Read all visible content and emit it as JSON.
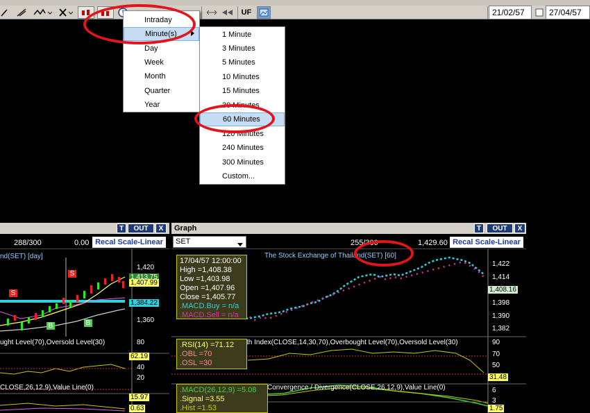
{
  "toolbar": {
    "uf_label": "UF",
    "date_from": "21/02/57",
    "date_to": "27/04/57"
  },
  "period_menu": {
    "items": [
      "Intraday",
      "Minute(s)",
      "Day",
      "Week",
      "Month",
      "Quarter",
      "Year"
    ],
    "selected": "Minute(s)"
  },
  "minutes_menu": {
    "items": [
      "1 Minute",
      "3 Minutes",
      "5 Minutes",
      "10 Minutes",
      "15 Minutes",
      "30 Minutes",
      "60 Minutes",
      "120 Minutes",
      "240 Minutes",
      "300 Minutes",
      "Custom..."
    ],
    "selected": "60 Minutes"
  },
  "left_panel": {
    "btn_t": "T",
    "btn_out": "OUT",
    "btn_x": "X",
    "count": "288/300",
    "value": "0.00",
    "recal": "Recal Scale-Linear",
    "chart_title": "nd(SET) [day]",
    "price_ticks": [
      "1,420",
      "1,360"
    ],
    "price_hl1": "1,413.75",
    "price_hl2": "1,407.99",
    "price_hl3": "1,384.22",
    "markers": [
      "S",
      "S",
      "B",
      "B"
    ],
    "rsi_title": "ught Level(70),Oversold Level(30)",
    "rsi_ticks": [
      "80",
      "40",
      "20"
    ],
    "rsi_hl": "62.19",
    "macd_title": "CLOSE,26,12,9),Value Line(0)",
    "macd_hl1": "15.97",
    "macd_hl2": "0.63"
  },
  "graph_panel": {
    "title": "Graph",
    "btn_t": "T",
    "btn_out": "OUT",
    "btn_x": "X",
    "symbol": "SET",
    "count": "255/300",
    "value": "1,429.60",
    "recal": "Recal Scale-Linear",
    "chart_title": "The Stock Exchange of Thailand(SET) [60]",
    "info": {
      "time": "17/04/57 12:00:00",
      "high": "High  =1,408.38",
      "low": "Low   =1,403.98",
      "open": "Open  =1,407.96",
      "close": "Close =1,405.77",
      "macd_buy": ".MACD.Buy  = n/a",
      "macd_sell": ".MACD.Sell  = n/a"
    },
    "price_ticks": [
      "1,422",
      "1,414",
      "1,398",
      "1,390",
      "1,382"
    ],
    "price_hl": "1,408.16",
    "rsi_title": "th Index(CLOSE,14,30,70),Overbought Level(70),Oversold Level(30)",
    "rsi_info": {
      "rsi": ".RSI(14)  =71.12",
      "obl": ".OBL  =70",
      "osl": ".OSL  =30"
    },
    "rsi_ticks": [
      "90",
      "70",
      "50"
    ],
    "rsi_hl": "31.48",
    "macd_title": "Convergence / Divergence(CLOSE,26,12,9),Value Line(0)",
    "macd_info": {
      "macd": ".MACD(26,12,9)  =5.08",
      "signal": ".Signal  =3.55",
      "hist": ".Hist  =1.53"
    },
    "macd_ticks": [
      "6",
      "3"
    ],
    "macd_hl": "1.75"
  },
  "colors": {
    "toolbar_bg": "#d4d0c8",
    "highlight": "#c6dcf2",
    "annotation": "#e2141c",
    "title_bar": "#1e3a78"
  }
}
